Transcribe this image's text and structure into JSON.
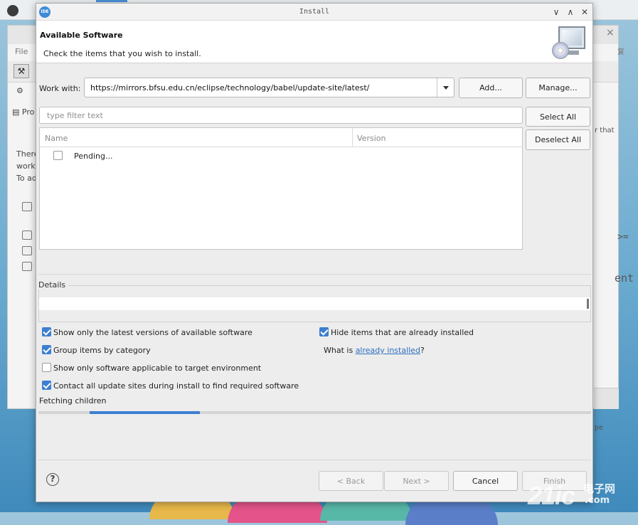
{
  "background": {
    "menu_label": "File",
    "project_label": "Pro",
    "left_text": [
      "There",
      "works",
      "To ad"
    ],
    "right_text_1": "r that",
    "right_text_2": ">=",
    "right_text_3": "ent",
    "right_text_4": "pe",
    "right_close": "×",
    "right_label": "复",
    "watermark_main": "21ic",
    "watermark_cn": "电子网",
    "watermark_com": ".com"
  },
  "dialog": {
    "title": "Install",
    "app_icon": "IDE",
    "controls": {
      "minimize": "∨",
      "maximize": "∧",
      "close": "✕"
    },
    "header_title": "Available Software",
    "header_subtitle": "Check the items that you wish to install.",
    "work_with_label": "Work with:",
    "work_with_value": "https://mirrors.bfsu.edu.cn/eclipse/technology/babel/update-site/latest/",
    "add_button": "Add...",
    "manage_button": "Manage...",
    "filter_placeholder": "type filter text",
    "select_all_button": "Select All",
    "deselect_all_button": "Deselect All",
    "table": {
      "columns": [
        "Name",
        "Version"
      ],
      "rows": [
        {
          "name": "Pending...",
          "version": "",
          "checked": false
        }
      ]
    },
    "details_label": "Details",
    "options": [
      {
        "label": "Show only the latest versions of available software",
        "checked": true
      },
      {
        "label": "Group items by category",
        "checked": true
      },
      {
        "label": "Show only software applicable to target environment",
        "checked": false
      },
      {
        "label": "Contact all update sites during install to find required software",
        "checked": true
      },
      {
        "label": "Hide items that are already installed",
        "checked": true
      }
    ],
    "what_is_prefix": "What is ",
    "what_is_link": "already installed",
    "what_is_suffix": "?",
    "status_text": "Fetching children",
    "progress_fraction": 0.2,
    "help_icon": "?",
    "buttons": {
      "back": "< Back",
      "next": "Next >",
      "cancel": "Cancel",
      "finish": "Finish"
    },
    "accent_color": "#3d7fd1"
  }
}
